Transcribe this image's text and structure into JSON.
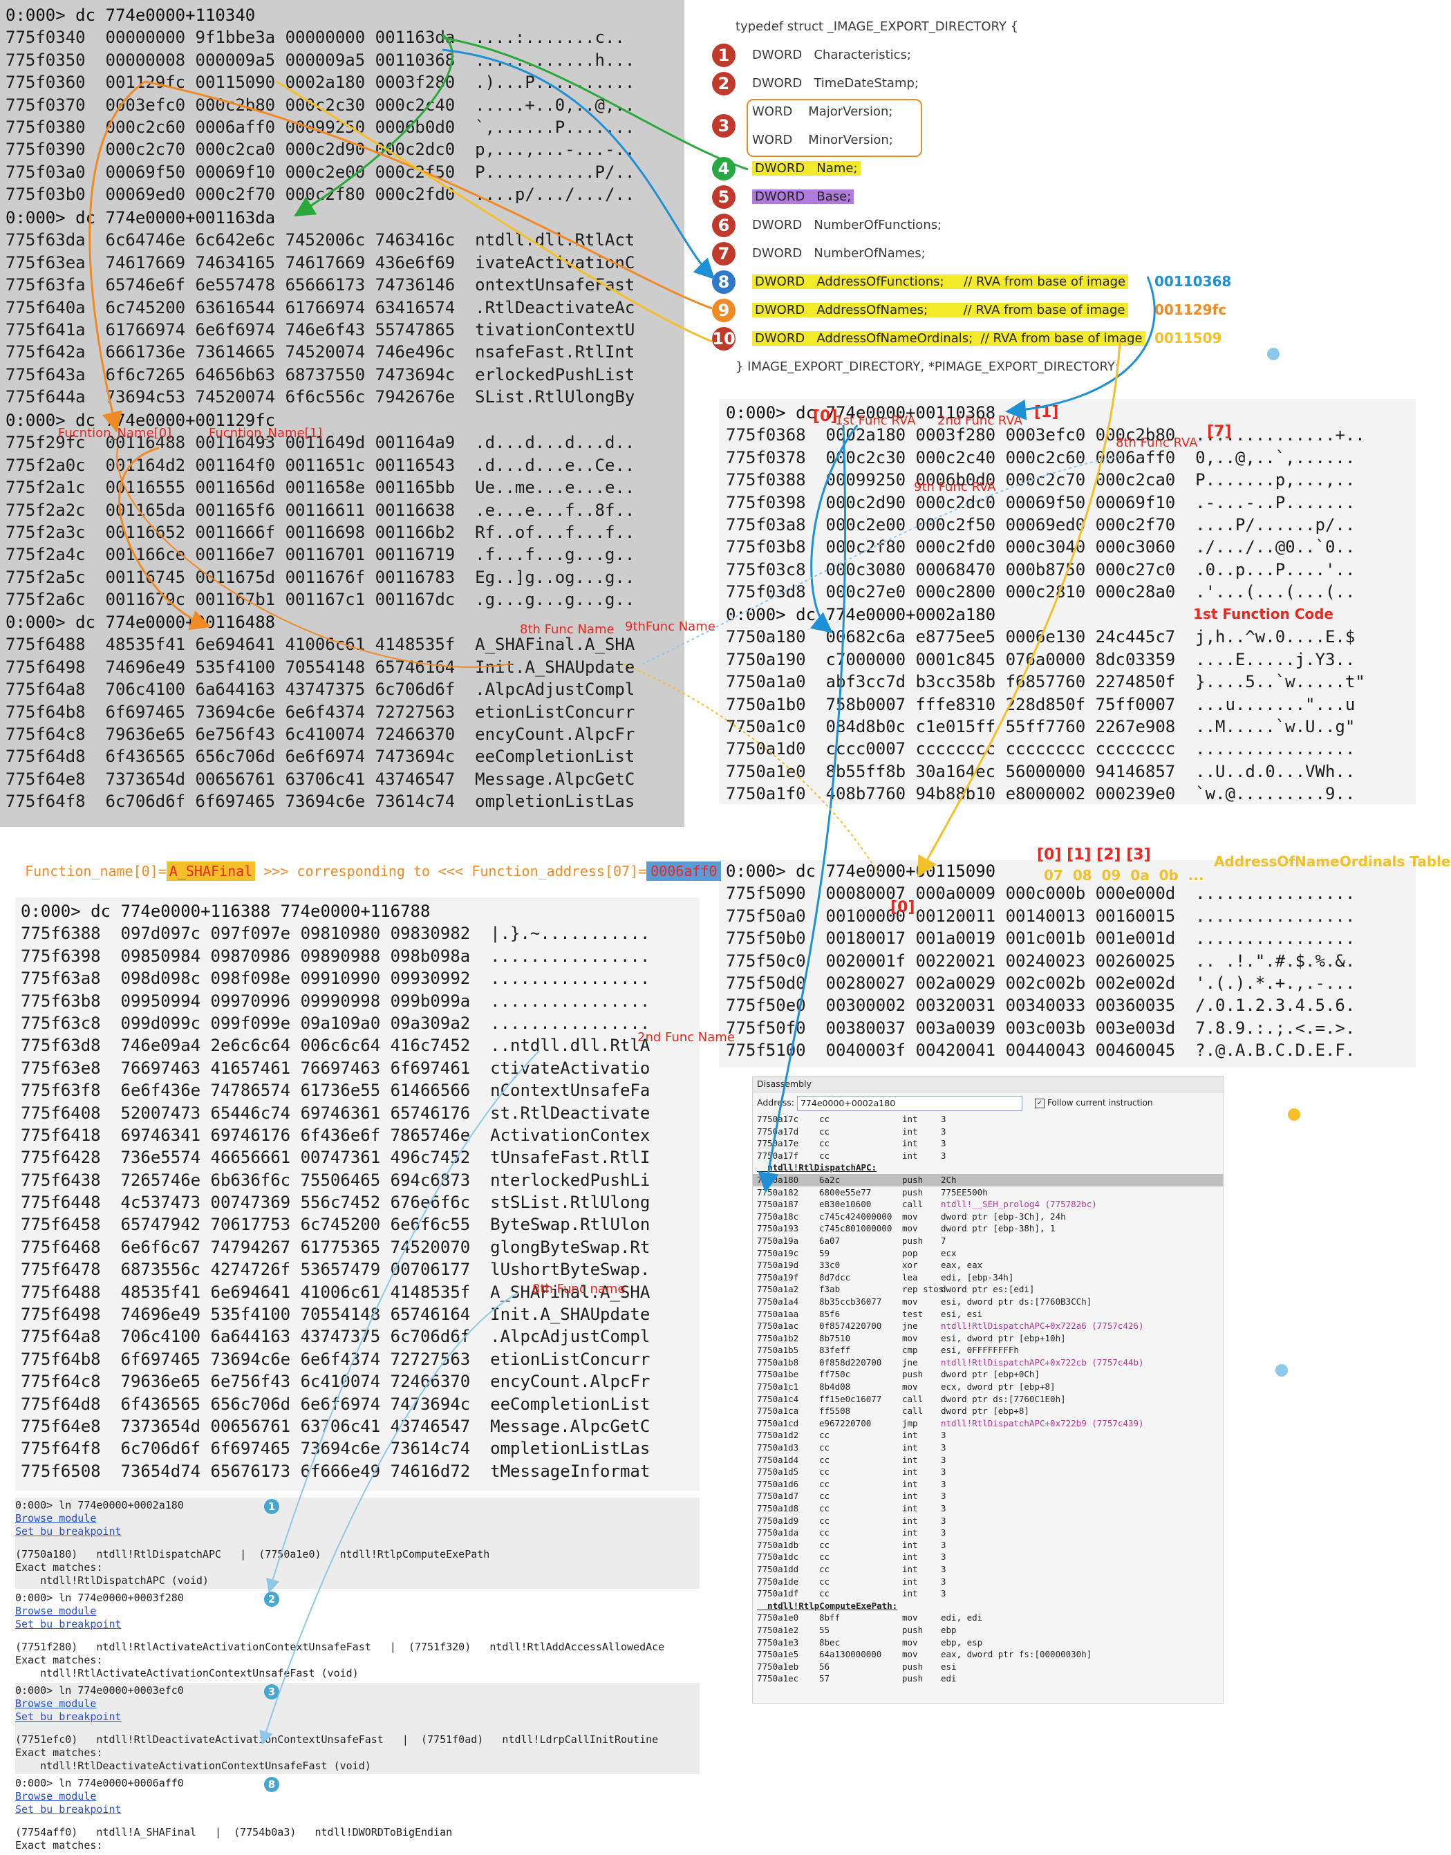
{
  "top_left_dump": {
    "header": "0:000> dc 774e0000+110340",
    "rows": [
      "775f0340  00000000 9f1bbe3a 00000000 001163da  ....:.......c..",
      "775f0350  00000008 000009a5 000009a5 00110368  ............h...",
      "775f0360  001129fc 00115090 0002a180 0003f280  .)...P..........",
      "775f0370  0003efc0 000c2b80 000c2c30 000c2c40  .....+..0,..@,..",
      "775f0380  000c2c60 0006aff0 00099250 0006b0d0  `,......P.......",
      "775f0390  000c2c70 000c2ca0 000c2d90 000c2dc0  p,...,...-...-..",
      "775f03a0  00069f50 00069f10 000c2e00 000c2f50  P...........P/..",
      "775f03b0  00069ed0 000c2f70 000c2f80 000c2fd0  ....p/.../.../.."
    ]
  },
  "names_dump": {
    "header": "0:000> dc 774e0000+001163da",
    "rows": [
      "775f63da  6c64746e 6c642e6c 7452006c 7463416c  ntdll.dll.RtlAct",
      "775f63ea  74617669 74634165 74617669 436e6f69  ivateActivationC",
      "775f63fa  65746e6f 6e557478 65666173 74736146  ontextUnsafeFast",
      "775f640a  6c745200 63616544 61766974 63416574  .RtlDeactivateAc",
      "775f641a  61766974 6e6f6974 746e6f43 55747865  tivationContextU",
      "775f642a  6661736e 73614665 74520074 746e496c  nsafeFast.RtlInt",
      "775f643a  6f6c7265 64656b63 68737550 7473694c  erlockedPushList",
      "775f644a  73694c53 74520074 6f6c556c 7942676e  SList.RtlUlongBy"
    ]
  },
  "name_table_dump": {
    "header": "0:000> dc 774e0000+001129fc",
    "rows": [
      "775f29fc  00116488 00116493 0011649d 001164a9  .d...d...d...d..",
      "775f2a0c  001164d2 001164f0 0011651c 00116543  .d...d...e..Ce..",
      "775f2a1c  00116555 0011656d 0011658e 001165bb  Ue..me...e...e..",
      "775f2a2c  001165da 001165f6 00116611 00116638  .e...e...f..8f..",
      "775f2a3c  00116652 0011666f 00116698 001166b2  Rf..of...f...f..",
      "775f2a4c  001166ce 001166e7 00116701 00116719  .f...f...g...g..",
      "775f2a5c  00116745 0011675d 0011676f 00116783  Eg..]g..og...g..",
      "775f2a6c  0011679c 001167b1 001167c1 001167dc  .g...g...g...g.."
    ]
  },
  "first_name_dump": {
    "header": "0:000> dc 774e0000+00116488",
    "rows": [
      "775f6488  48535f41 6e694641 41006c61 4148535f  A_SHAFinal.A_SHA",
      "775f6498  74696e49 535f4100 70554148 65746164  Init.A_SHAUpdate",
      "775f64a8  706c4100 6a644163 43747375 6c706d6f  .AlpcAdjustCompl",
      "775f64b8  6f697465 73694c6e 6e6f4374 72727563  etionListConcurr",
      "775f64c8  79636e65 6e756f43 6c410074 72466370  encyCount.AlpcFr",
      "775f64d8  6f436565 656c706d 6e6f6974 7473694c  eeCompletionList",
      "775f64e8  7373654d 00656761 63706c41 43746547  Message.AlpcGetC",
      "775f64f8  6c706d6f 6f697465 73694c6e 73614c74  ompletionListLas"
    ]
  },
  "struct": {
    "lines": [
      {
        "n": "",
        "text": "typedef struct _IMAGE_EXPORT_DIRECTORY {"
      },
      {
        "n": "1",
        "text": "DWORD   Characteristics;"
      },
      {
        "n": "2",
        "text": "DWORD   TimeDateStamp;"
      },
      {
        "n": "",
        "text": "WORD    MajorVersion;"
      },
      {
        "n": "",
        "text": "WORD    MinorVersion;"
      },
      {
        "n": "4",
        "text": "DWORD   Name;"
      },
      {
        "n": "5",
        "text": "DWORD   Base;"
      },
      {
        "n": "6",
        "text": "DWORD   NumberOfFunctions;"
      },
      {
        "n": "7",
        "text": "DWORD   NumberOfNames;"
      },
      {
        "n": "8",
        "text": "DWORD   AddressOfFunctions;     // RVA from base of image"
      },
      {
        "n": "9",
        "text": "DWORD   AddressOfNames;         // RVA from base of image"
      },
      {
        "n": "10",
        "text": "DWORD   AddressOfNameOrdinals;  // RVA from base of image"
      },
      {
        "n": "",
        "text": "} IMAGE_EXPORT_DIRECTORY, *PIMAGE_EXPORT_DIRECTORY;"
      }
    ],
    "major_num": "3",
    "val_functions": "00110368",
    "val_names": "001129fc",
    "val_ordinals": "0011509"
  },
  "func_table_dump": {
    "header": "0:000> dc 774e0000+00110368",
    "rows": [
      "775f0368  0002a180 0003f280 0003efc0 000c2b80  ..............+..",
      "775f0378  000c2c30 000c2c40 000c2c60 0006aff0  0,..@,..`,......",
      "775f0388  00099250 0006b0d0 000c2c70 000c2ca0  P.......p,...,..",
      "775f0398  000c2d90 000c2dc0 00069f50 00069f10  .-...-..P.......",
      "775f03a8  000c2e00 000c2f50 00069ed0 000c2f70  ....P/......p/..",
      "775f03b8  000c2f80 000c2fd0 000c3040 000c3060  ./.../..@0..`0..",
      "775f03c8  000c3080 00068470 000b8750 000c27c0  .0..p...P....'..",
      "775f03d8  000c27e0 000c2800 000c2810 000c28a0  .'...(...(...(.."
    ]
  },
  "func_code_dump": {
    "header": "0:000> dc 774e0000+0002a180",
    "rows": [
      "7750a180  00682c6a e8775ee5 0006e130 24c445c7  j,h..^w.0....E.$",
      "7750a190  c7000000 0001c845 076a0000 8dc03359  ....E.....j.Y3..",
      "7750a1a0  abf3cc7d b3cc358b f6857760 2274850f  }....5..`w.....t\"",
      "7750a1b0  758b0007 fffe8310 228d850f 75ff0007  ...u.......\"...u",
      "7750a1c0  084d8b0c c1e015ff 55ff7760 2267e908  ..M.....`w.U..g\"",
      "7750a1d0  cccc0007 cccccccc cccccccc cccccccc  ................",
      "7750a1e0  8b55ff8b 30a164ec 56000000 94146857  ..U..d.0...VWh..",
      "7750a1f0  408b7760 94b88b10 e8000002 000239e0  `w.@.........9.."
    ]
  },
  "ordinals_dump": {
    "header": "0:000> dc 774e0000+00115090",
    "rows": [
      "775f5090  00080007 000a0009 000c000b 000e000d  ................",
      "775f50a0  00100000 00120011 00140013 00160015  ................",
      "775f50b0  00180017 001a0019 001c001b 001e001d  ................",
      "775f50c0  0020001f 00220021 00240023 00260025  .. .!.\".#.$.%.&.",
      "775f50d0  00280027 002a0029 002c002b 002e002d  '.(.).*.+.,.-...",
      "775f50e0  00300002 00320031 00340033 00360035  /.0.1.2.3.4.5.6.",
      "775f50f0  00380037 003a0039 003c003b 003e003d  7.8.9.:.;.<.=.>.",
      "775f5100  0040003f 00420041 00440043 00460045  ?.@.A.B.C.D.E.F."
    ]
  },
  "big_dump": {
    "header": "0:000> dc 774e0000+116388 774e0000+116788",
    "rows": [
      "775f6388  097d097c 097f097e 09810980 09830982  |.}.~...........",
      "775f6398  09850984 09870986 09890988 098b098a  ................",
      "775f63a8  098d098c 098f098e 09910990 09930992  ................",
      "775f63b8  09950994 09970996 09990998 099b099a  ................",
      "775f63c8  099d099c 099f099e 09a109a0 09a309a2  ................",
      "775f63d8  746e09a4 2e6c6c64 006c6c64 416c7452  ..ntdll.dll.RtlA",
      "775f63e8  76697463 41657461 76697463 6f697461  ctivateActivatio",
      "775f63f8  6e6f436e 74786574 61736e55 61466566  nContextUnsafeFa",
      "775f6408  52007473 65446c74 69746361 65746176  st.RtlDeactivate",
      "775f6418  69746341 69746176 6f436e6f 7865746e  ActivationContex",
      "775f6428  736e5574 46656661 00747361 496c7452  tUnsafeFast.RtlI",
      "775f6438  7265746e 6b636f6c 75506465 694c6873  nterlockedPushLi",
      "775f6448  4c537473 00747369 556c7452 676e6f6c  stSList.RtlUlong",
      "775f6458  65747942 70617753 6c745200 6e6f6c55  ByteSwap.RtlUlon",
      "775f6468  6e6f6c67 74794267 61775365 74520070  glongByteSwap.Rt",
      "775f6478  6873556c 4274726f 53657479 00706177  lUshortByteSwap.",
      "775f6488  48535f41 6e694641 41006c61 4148535f  A_SHAFinal.A_SHA",
      "775f6498  74696e49 535f4100 70554148 65746164  Init.A_SHAUpdate",
      "775f64a8  706c4100 6a644163 43747375 6c706d6f  .AlpcAdjustCompl",
      "775f64b8  6f697465 73694c6e 6e6f4374 72727563  etionListConcurr",
      "775f64c8  79636e65 6e756f43 6c410074 72466370  encyCount.AlpcFr",
      "775f64d8  6f436565 656c706d 6e6f6974 7473694c  eeCompletionList",
      "775f64e8  7373654d 00656761 63706c41 43746547  Message.AlpcGetC",
      "775f64f8  6c706d6f 6f697465 73694c6e 73614c74  ompletionListLas",
      "775f6508  73654d74 65676173 6f666e49 74616d72  tMessageInformat"
    ]
  },
  "ln_results": [
    {
      "cmd": "0:000> ln 774e0000+0002a180",
      "links": [
        "Browse module",
        "Set bu breakpoint"
      ],
      "sym": "(7750a180)   ntdll!RtlDispatchAPC   |  (7750a1e0)   ntdll!RtlpComputeExePath",
      "exact": "Exact matches:",
      "match": "    ntdll!RtlDispatchAPC (void)",
      "bubble": "1"
    },
    {
      "cmd": "0:000> ln 774e0000+0003f280",
      "links": [
        "Browse module",
        "Set bu breakpoint"
      ],
      "sym": "(7751f280)   ntdll!RtlActivateActivationContextUnsafeFast   |  (7751f320)   ntdll!RtlAddAccessAllowedAce",
      "exact": "Exact matches:",
      "match": "    ntdll!RtlActivateActivationContextUnsafeFast (void)",
      "bubble": "2"
    },
    {
      "cmd": "0:000> ln 774e0000+0003efc0",
      "links": [
        "Browse module",
        "Set bu breakpoint"
      ],
      "sym": "(7751efc0)   ntdll!RtlDeactivateActivationContextUnsafeFast   |  (7751f0ad)   ntdll!LdrpCallInitRoutine",
      "exact": "Exact matches:",
      "match": "    ntdll!RtlDeactivateActivationContextUnsafeFast (void)",
      "bubble": "3"
    },
    {
      "cmd": "0:000> ln 774e0000+0006aff0",
      "links": [
        "Browse module",
        "Set bu breakpoint"
      ],
      "sym": "(7754aff0)   ntdll!A_SHAFinal   |  (7754b0a3)   ntdll!DWORDToBigEndian",
      "exact": "Exact matches:",
      "match": "",
      "bubble": "8"
    }
  ],
  "disasm": {
    "title": "Disassembly",
    "address_label": "Address:",
    "address_value": "774e0000+0002a180",
    "follow_label": "Follow current instruction",
    "rows": [
      [
        "7750a17c cc",
        "",
        "int",
        "3"
      ],
      [
        "7750a17d cc",
        "",
        "int",
        "3"
      ],
      [
        "7750a17e cc",
        "",
        "int",
        "3"
      ],
      [
        "7750a17f cc",
        "",
        "int",
        "3"
      ],
      [
        "LABEL",
        "ntdll!RtlDispatchAPC:",
        "",
        ""
      ],
      [
        "7750a180 6a2c",
        "",
        "push",
        "2Ch"
      ],
      [
        "7750a182 6800e55e77",
        "",
        "push",
        "775EE500h"
      ],
      [
        "7750a187 e830e10600",
        "",
        "call",
        "ntdll!__SEH_prolog4 (775782bc)"
      ],
      [
        "7750a18c c745c424000000",
        "",
        "mov",
        "dword ptr [ebp-3Ch], 24h"
      ],
      [
        "7750a193 c745c801000000",
        "",
        "mov",
        "dword ptr [ebp-38h], 1"
      ],
      [
        "7750a19a 6a07",
        "",
        "push",
        "7"
      ],
      [
        "7750a19c 59",
        "",
        "pop",
        "ecx"
      ],
      [
        "7750a19d 33c0",
        "",
        "xor",
        "eax, eax"
      ],
      [
        "7750a19f 8d7dcc",
        "",
        "lea",
        "edi, [ebp-34h]"
      ],
      [
        "7750a1a2 f3ab",
        "",
        "rep stos",
        "dword ptr es:[edi]"
      ],
      [
        "7750a1a4 8b35ccb36077",
        "",
        "mov",
        "esi, dword ptr ds:[7760B3CCh]"
      ],
      [
        "7750a1aa 85f6",
        "",
        "test",
        "esi, esi"
      ],
      [
        "7750a1ac 0f8574220700",
        "",
        "jne",
        "ntdll!RtlDispatchAPC+0x722a6 (7757c426)"
      ],
      [
        "7750a1b2 8b7510",
        "",
        "mov",
        "esi, dword ptr [ebp+10h]"
      ],
      [
        "7750a1b5 83feff",
        "",
        "cmp",
        "esi, 0FFFFFFFFh"
      ],
      [
        "7750a1b8 0f858d220700",
        "",
        "jne",
        "ntdll!RtlDispatchAPC+0x722cb (7757c44b)"
      ],
      [
        "7750a1be ff750c",
        "",
        "push",
        "dword ptr [ebp+0Ch]"
      ],
      [
        "7750a1c1 8b4d08",
        "",
        "mov",
        "ecx, dword ptr [ebp+8]"
      ],
      [
        "7750a1c4 ff15e0c16077",
        "",
        "call",
        "dword ptr ds:[7760C1E0h]"
      ],
      [
        "7750a1ca ff5508",
        "",
        "call",
        "dword ptr [ebp+8]"
      ],
      [
        "7750a1cd e967220700",
        "",
        "jmp",
        "ntdll!RtlDispatchAPC+0x722b9 (7757c439)"
      ],
      [
        "7750a1d2 cc",
        "",
        "int",
        "3"
      ],
      [
        "7750a1d3 cc",
        "",
        "int",
        "3"
      ],
      [
        "7750a1d4 cc",
        "",
        "int",
        "3"
      ],
      [
        "7750a1d5 cc",
        "",
        "int",
        "3"
      ],
      [
        "7750a1d6 cc",
        "",
        "int",
        "3"
      ],
      [
        "7750a1d7 cc",
        "",
        "int",
        "3"
      ],
      [
        "7750a1d8 cc",
        "",
        "int",
        "3"
      ],
      [
        "7750a1d9 cc",
        "",
        "int",
        "3"
      ],
      [
        "7750a1da cc",
        "",
        "int",
        "3"
      ],
      [
        "7750a1db cc",
        "",
        "int",
        "3"
      ],
      [
        "7750a1dc cc",
        "",
        "int",
        "3"
      ],
      [
        "7750a1dd cc",
        "",
        "int",
        "3"
      ],
      [
        "7750a1de cc",
        "",
        "int",
        "3"
      ],
      [
        "7750a1df cc",
        "",
        "int",
        "3"
      ],
      [
        "LABEL",
        "ntdll!RtlpComputeExePath:",
        "",
        ""
      ],
      [
        "7750a1e0 8bff",
        "",
        "mov",
        "edi, edi"
      ],
      [
        "7750a1e2 55",
        "",
        "push",
        "ebp"
      ],
      [
        "7750a1e3 8bec",
        "",
        "mov",
        "ebp, esp"
      ],
      [
        "7750a1e5 64a130000000",
        "",
        "mov",
        "eax, dword ptr fs:[00000030h]"
      ],
      [
        "7750a1eb 56",
        "",
        "push",
        "esi"
      ],
      [
        "7750a1ec 57",
        "",
        "push",
        "edi"
      ]
    ]
  },
  "annotations": {
    "func_name0": "Fucntion_Name[0]",
    "func_name1": "Fucntion_Name[1]",
    "first_rva": "1st Func RVA",
    "second_rva": "2nd Func RVA",
    "eighth_rva": "8th Func RVA",
    "ninth_rva": "9th Func RVA",
    "idx0": "[0]",
    "idx1": "[1]",
    "idx7": "[7]",
    "idx0b": "[0]",
    "first_code": "1st Function Code",
    "eighth_name": "8th Func Name",
    "ninth_name": "9thFunc Name",
    "second_name": "2nd Func Name",
    "eighth_name_b": "8th Func name",
    "ord_indices": "[0] [1] [2] [3]",
    "ord_values": "07  08  09  0a  0b  ...",
    "ord_table": "AddressOfNameOrdinals Table",
    "correspond_a": "Function_name[0]=",
    "correspond_b": "A_SHAFinal",
    "correspond_c": " >>> corresponding to <<< Function_address[07]=",
    "correspond_d": "0006aff0"
  },
  "colors": {
    "red": "#e8281e",
    "orange": "#f08a24",
    "blue": "#1e90d6",
    "yellow": "#f3ea2a",
    "green": "#2aa83a"
  }
}
